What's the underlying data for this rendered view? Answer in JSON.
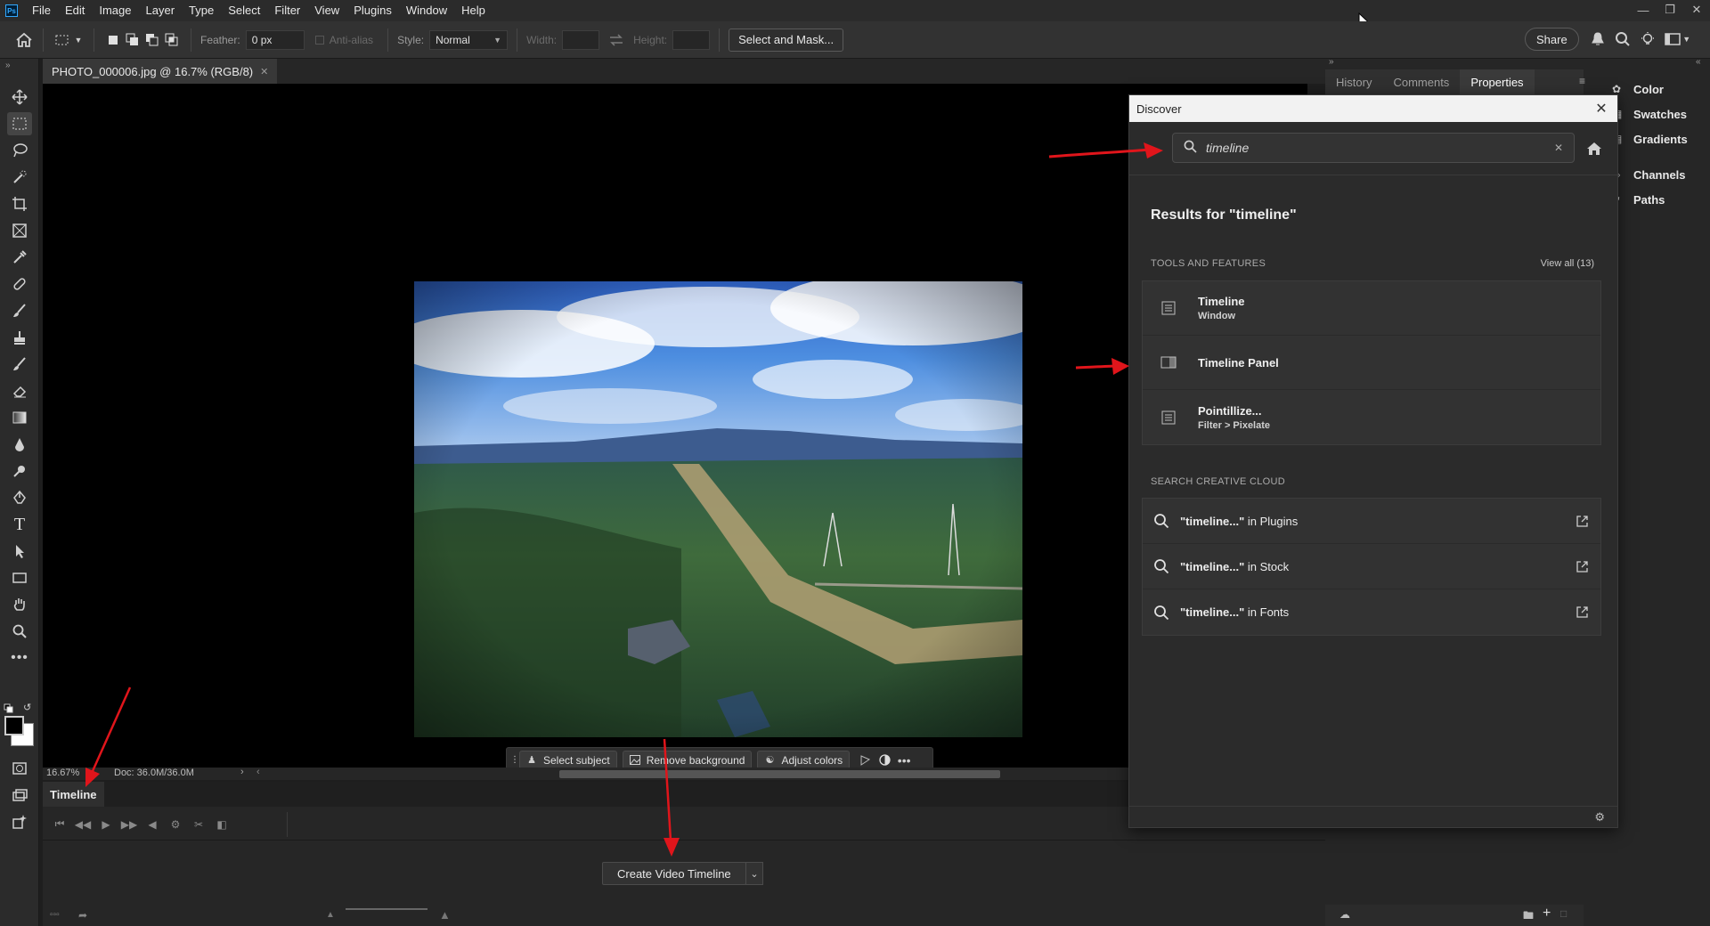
{
  "menu": [
    "File",
    "Edit",
    "Image",
    "Layer",
    "Type",
    "Select",
    "Filter",
    "View",
    "Plugins",
    "Window",
    "Help"
  ],
  "options": {
    "feather_label": "Feather:",
    "feather_value": "0 px",
    "antialias_label": "Anti-alias",
    "style_label": "Style:",
    "style_value": "Normal",
    "width_label": "Width:",
    "height_label": "Height:",
    "select_mask": "Select and Mask...",
    "share": "Share"
  },
  "document": {
    "tab_title": "PHOTO_000006.jpg @ 16.7% (RGB/8)",
    "zoom": "16.67%",
    "doc_size": "Doc: 36.0M/36.0M"
  },
  "context_bar": {
    "select_subject": "Select subject",
    "remove_background": "Remove background",
    "adjust_colors": "Adjust colors"
  },
  "timeline": {
    "tab": "Timeline",
    "create_button": "Create Video Timeline"
  },
  "right_panels": {
    "tabs": [
      "History",
      "Comments",
      "Properties"
    ],
    "active_tab": "Properties",
    "mini": [
      "Color",
      "Swatches",
      "Gradients",
      "Channels",
      "Paths"
    ]
  },
  "discover": {
    "title": "Discover",
    "search_value": "timeline",
    "results_title": "Results for \"timeline\"",
    "tools_section": "TOOLS AND FEATURES",
    "view_all": "View all (13)",
    "results": [
      {
        "title": "Timeline",
        "subtitle": "Window"
      },
      {
        "title": "Timeline Panel",
        "subtitle": ""
      },
      {
        "title": "Pointillize...",
        "subtitle": "Filter > Pixelate"
      }
    ],
    "cc_section": "SEARCH CREATIVE CLOUD",
    "cc_results": [
      {
        "query": "\"timeline...\"",
        "where": " in Plugins"
      },
      {
        "query": "\"timeline...\"",
        "where": " in Stock"
      },
      {
        "query": "\"timeline...\"",
        "where": " in Fonts"
      }
    ]
  },
  "colors": {
    "annotation_red": "#e0151b",
    "accent_blue": "#31a8ff"
  }
}
